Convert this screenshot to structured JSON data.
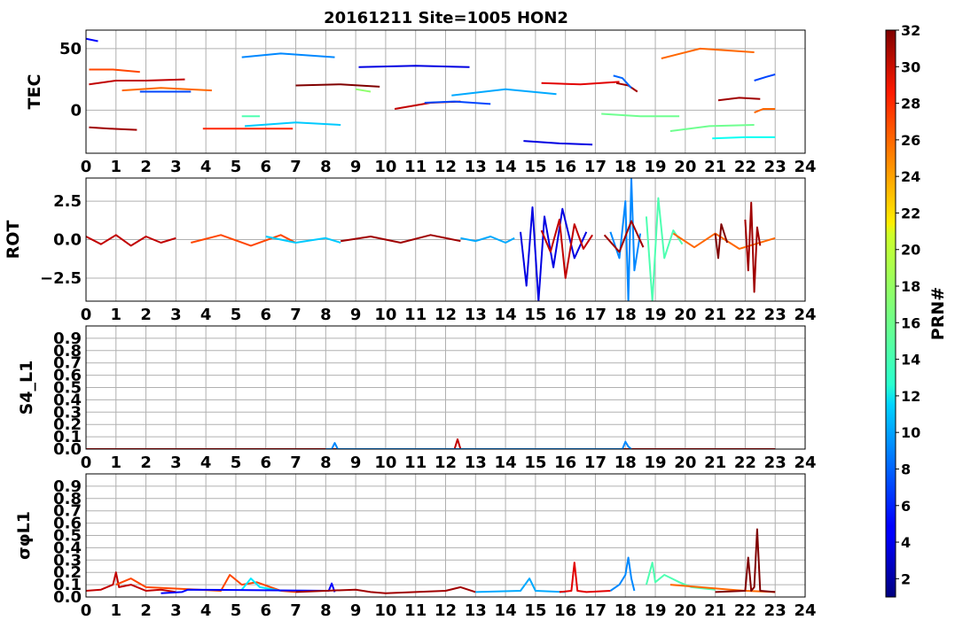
{
  "chart_data": {
    "type": "line",
    "title": "20161211 Site=1005 HON2",
    "x_ticks": [
      "0",
      "1",
      "2",
      "3",
      "4",
      "5",
      "6",
      "7",
      "8",
      "9",
      "10",
      "11",
      "12",
      "13",
      "14",
      "15",
      "16",
      "17",
      "18",
      "19",
      "20",
      "21",
      "22",
      "23",
      "24"
    ],
    "xlim": [
      0,
      24
    ],
    "grid": true,
    "colorbar": {
      "label": "PRN#",
      "range": [
        1,
        32
      ],
      "ticks": [
        "2",
        "4",
        "6",
        "8",
        "10",
        "12",
        "14",
        "16",
        "18",
        "20",
        "22",
        "24",
        "26",
        "28",
        "30",
        "32"
      ],
      "colormap": "jet"
    },
    "panels": [
      {
        "ylabel": "TEC",
        "ylim": [
          -35,
          65
        ],
        "yticks": [
          "50",
          "0"
        ],
        "series": [
          {
            "prn": 5,
            "x": [
              0.0,
              0.4
            ],
            "y": [
              58,
              56
            ]
          },
          {
            "prn": 26,
            "x": [
              0.1,
              0.9,
              1.8
            ],
            "y": [
              33,
              33,
              31
            ]
          },
          {
            "prn": 30,
            "x": [
              0.1,
              1.0,
              2.0,
              3.3
            ],
            "y": [
              21,
              24,
              24,
              25
            ]
          },
          {
            "prn": 25,
            "x": [
              1.2,
              2.5,
              4.2
            ],
            "y": [
              16,
              18,
              16
            ]
          },
          {
            "prn": 7,
            "x": [
              1.8,
              2.5,
              3.5
            ],
            "y": [
              15,
              15,
              15
            ]
          },
          {
            "prn": 31,
            "x": [
              0.1,
              0.8,
              1.7
            ],
            "y": [
              -14,
              -15,
              -16
            ]
          },
          {
            "prn": 27,
            "x": [
              3.9,
              5.0,
              6.9
            ],
            "y": [
              -15,
              -15,
              -15
            ]
          },
          {
            "prn": 9,
            "x": [
              5.2,
              6.5,
              8.3
            ],
            "y": [
              43,
              46,
              43
            ]
          },
          {
            "prn": 15,
            "x": [
              5.2,
              5.5,
              5.8
            ],
            "y": [
              -5,
              -5,
              -5
            ]
          },
          {
            "prn": 11,
            "x": [
              5.3,
              7.0,
              8.5
            ],
            "y": [
              -13,
              -10,
              -12
            ]
          },
          {
            "prn": 32,
            "x": [
              7.0,
              8.5,
              9.8
            ],
            "y": [
              20,
              21,
              19
            ]
          },
          {
            "prn": 17,
            "x": [
              9.0,
              9.5
            ],
            "y": [
              17,
              15
            ]
          },
          {
            "prn": 4,
            "x": [
              9.1,
              11.0,
              12.8
            ],
            "y": [
              35,
              36,
              35
            ]
          },
          {
            "prn": 30,
            "x": [
              10.3,
              11.5,
              12.5
            ],
            "y": [
              1,
              6,
              7
            ]
          },
          {
            "prn": 7,
            "x": [
              11.3,
              12.3,
              13.5
            ],
            "y": [
              6,
              7,
              5
            ]
          },
          {
            "prn": 10,
            "x": [
              12.2,
              14.0,
              15.7
            ],
            "y": [
              12,
              17,
              13
            ]
          },
          {
            "prn": 29,
            "x": [
              15.2,
              16.5,
              17.8
            ],
            "y": [
              22,
              21,
              23
            ]
          },
          {
            "prn": 31,
            "x": [
              17.7,
              18.1,
              18.4
            ],
            "y": [
              22,
              20,
              15
            ]
          },
          {
            "prn": 8,
            "x": [
              17.6,
              17.9,
              18.2
            ],
            "y": [
              28,
              26,
              18
            ]
          },
          {
            "prn": 4,
            "x": [
              14.6,
              15.8,
              16.9
            ],
            "y": [
              -25,
              -27,
              -28
            ]
          },
          {
            "prn": 16,
            "x": [
              17.2,
              18.5,
              19.8
            ],
            "y": [
              -3,
              -5,
              -5
            ]
          },
          {
            "prn": 25,
            "x": [
              19.2,
              20.5,
              22.3
            ],
            "y": [
              42,
              50,
              47
            ]
          },
          {
            "prn": 16,
            "x": [
              19.5,
              20.8,
              22.3
            ],
            "y": [
              -17,
              -13,
              -12
            ]
          },
          {
            "prn": 13,
            "x": [
              20.9,
              22.0,
              23.0
            ],
            "y": [
              -23,
              -22,
              -22
            ]
          },
          {
            "prn": 31,
            "x": [
              21.1,
              21.8,
              22.5
            ],
            "y": [
              8,
              10,
              9
            ]
          },
          {
            "prn": 7,
            "x": [
              22.3,
              22.7,
              23.0
            ],
            "y": [
              24,
              27,
              29
            ]
          },
          {
            "prn": 25,
            "x": [
              22.3,
              22.6,
              23.0
            ],
            "y": [
              -2,
              1,
              1
            ]
          }
        ]
      },
      {
        "ylabel": "ROT",
        "ylim": [
          -4,
          4
        ],
        "yticks": [
          "2.5",
          "0.0",
          "−2.5"
        ],
        "series": [
          {
            "prn": 30,
            "x": [
              0.0,
              0.5,
              1.0,
              1.5,
              2.0,
              2.5,
              3.0
            ],
            "y": [
              0.2,
              -0.3,
              0.3,
              -0.4,
              0.2,
              -0.2,
              0.1
            ]
          },
          {
            "prn": 26,
            "x": [
              3.5,
              4.5,
              5.5,
              6.5,
              7.0
            ],
            "y": [
              -0.2,
              0.3,
              -0.4,
              0.3,
              -0.2
            ]
          },
          {
            "prn": 11,
            "x": [
              6.0,
              7.0,
              8.0,
              8.5
            ],
            "y": [
              0.2,
              -0.2,
              0.1,
              -0.2
            ]
          },
          {
            "prn": 31,
            "x": [
              8.5,
              9.5,
              10.5,
              11.5,
              12.5
            ],
            "y": [
              -0.1,
              0.2,
              -0.2,
              0.3,
              -0.1
            ]
          },
          {
            "prn": 10,
            "x": [
              12.5,
              13.0,
              13.5,
              14.0,
              14.3
            ],
            "y": [
              0.1,
              -0.1,
              0.2,
              -0.2,
              0.1
            ]
          },
          {
            "prn": 4,
            "x": [
              14.5,
              14.7,
              14.9,
              15.1,
              15.3,
              15.6,
              15.9,
              16.3,
              16.7
            ],
            "y": [
              0.5,
              -3.0,
              2.1,
              -4.0,
              1.5,
              -1.8,
              2.0,
              -1.2,
              0.5
            ]
          },
          {
            "prn": 30,
            "x": [
              15.2,
              15.5,
              15.8,
              16.0,
              16.3,
              16.6,
              16.9
            ],
            "y": [
              0.6,
              -0.8,
              1.3,
              -2.5,
              1.0,
              -0.6,
              0.3
            ]
          },
          {
            "prn": 9,
            "x": [
              17.5,
              17.8,
              18.0,
              18.1,
              18.2,
              18.3,
              18.5
            ],
            "y": [
              0.5,
              -1.2,
              2.5,
              -4.0,
              4.0,
              -2.0,
              0.4
            ]
          },
          {
            "prn": 31,
            "x": [
              17.3,
              17.8,
              18.2,
              18.6
            ],
            "y": [
              0.3,
              -0.8,
              1.2,
              -0.5
            ]
          },
          {
            "prn": 15,
            "x": [
              18.7,
              18.9,
              19.1,
              19.3,
              19.6,
              19.9
            ],
            "y": [
              1.5,
              -4.0,
              2.7,
              -1.2,
              0.6,
              -0.3
            ]
          },
          {
            "prn": 25,
            "x": [
              19.6,
              20.3,
              21.0,
              21.8,
              23.0
            ],
            "y": [
              0.4,
              -0.5,
              0.4,
              -0.6,
              0.1
            ]
          },
          {
            "prn": 32,
            "x": [
              21.0,
              21.1,
              21.2,
              21.4
            ],
            "y": [
              0.4,
              -1.2,
              1.0,
              -0.2
            ]
          },
          {
            "prn": 31,
            "x": [
              22.0,
              22.1,
              22.2,
              22.3,
              22.4,
              22.5
            ],
            "y": [
              1.3,
              -2.0,
              2.4,
              -3.4,
              0.8,
              -0.4
            ]
          }
        ]
      },
      {
        "ylabel": "S4_L1",
        "ylim": [
          0,
          1
        ],
        "yticks": [
          "0.9",
          "0.8",
          "0.7",
          "0.6",
          "0.5",
          "0.4",
          "0.3",
          "0.2",
          "0.1",
          "0.0"
        ],
        "series": [
          {
            "prn": 30,
            "x": [
              0.0,
              5.0,
              10.0,
              12.3,
              12.4,
              12.5,
              23.0
            ],
            "y": [
              0.0,
              0.0,
              0.0,
              0.0,
              0.08,
              0.0,
              0.0
            ]
          },
          {
            "prn": 9,
            "x": [
              8.0,
              8.2,
              8.3,
              8.4,
              13.0,
              17.9,
              18.0,
              18.1,
              18.2
            ],
            "y": [
              0.0,
              0.0,
              0.05,
              0.0,
              0.0,
              0.0,
              0.06,
              0.02,
              0.0
            ]
          }
        ]
      },
      {
        "ylabel": "σφL1",
        "ylim": [
          0,
          1
        ],
        "yticks": [
          "0.9",
          "0.8",
          "0.7",
          "0.6",
          "0.5",
          "0.4",
          "0.3",
          "0.2",
          "0.1",
          "0.0"
        ],
        "series": [
          {
            "prn": 30,
            "x": [
              0.0,
              0.5,
              0.9,
              1.0,
              1.1,
              1.5,
              2.0,
              2.5,
              3.0
            ],
            "y": [
              0.05,
              0.06,
              0.1,
              0.2,
              0.08,
              0.1,
              0.05,
              0.06,
              0.04
            ]
          },
          {
            "prn": 26,
            "x": [
              1.0,
              1.5,
              2.0,
              4.5,
              4.8,
              5.2,
              5.7,
              6.5,
              7.0
            ],
            "y": [
              0.1,
              0.15,
              0.08,
              0.05,
              0.18,
              0.1,
              0.12,
              0.05,
              0.04
            ]
          },
          {
            "prn": 12,
            "x": [
              5.2,
              5.5,
              5.8,
              6.5
            ],
            "y": [
              0.06,
              0.15,
              0.08,
              0.05
            ]
          },
          {
            "prn": 5,
            "x": [
              2.5,
              3.2,
              3.4,
              8.1,
              8.2,
              8.3
            ],
            "y": [
              0.03,
              0.04,
              0.06,
              0.05,
              0.11,
              0.04
            ]
          },
          {
            "prn": 31,
            "x": [
              7.0,
              8.0,
              9.0,
              9.5,
              10.0,
              12.0,
              12.5,
              13.0
            ],
            "y": [
              0.04,
              0.05,
              0.06,
              0.04,
              0.03,
              0.05,
              0.08,
              0.04
            ]
          },
          {
            "prn": 10,
            "x": [
              13.0,
              14.5,
              14.8,
              15.0,
              16.0
            ],
            "y": [
              0.04,
              0.05,
              0.15,
              0.05,
              0.04
            ]
          },
          {
            "prn": 29,
            "x": [
              15.8,
              16.2,
              16.3,
              16.4,
              16.7,
              17.5
            ],
            "y": [
              0.04,
              0.05,
              0.28,
              0.05,
              0.04,
              0.05
            ]
          },
          {
            "prn": 9,
            "x": [
              17.5,
              17.8,
              18.0,
              18.1,
              18.2,
              18.3
            ],
            "y": [
              0.05,
              0.1,
              0.18,
              0.32,
              0.15,
              0.05
            ]
          },
          {
            "prn": 15,
            "x": [
              18.7,
              18.9,
              19.0,
              19.3,
              19.8,
              20.2,
              21.0
            ],
            "y": [
              0.1,
              0.28,
              0.12,
              0.18,
              0.12,
              0.08,
              0.06
            ]
          },
          {
            "prn": 25,
            "x": [
              19.5,
              20.5,
              21.5,
              22.0,
              23.0
            ],
            "y": [
              0.1,
              0.08,
              0.06,
              0.05,
              0.04
            ]
          },
          {
            "prn": 32,
            "x": [
              21.0,
              22.0,
              22.1,
              22.2,
              22.3,
              22.4,
              22.5,
              23.0
            ],
            "y": [
              0.04,
              0.05,
              0.32,
              0.05,
              0.08,
              0.55,
              0.05,
              0.04
            ]
          }
        ]
      }
    ]
  }
}
